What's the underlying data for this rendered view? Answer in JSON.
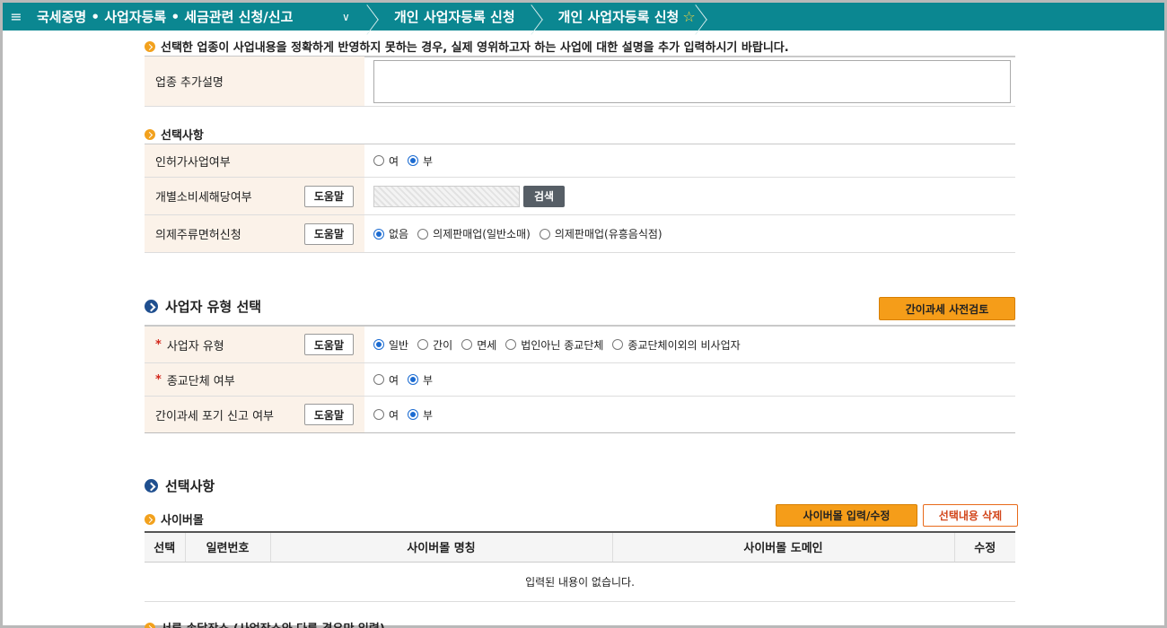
{
  "header": {
    "menu_glyph": "≡",
    "breadcrumb_root": "국세증명 • 사업자등록 • 세금관련 신청/신고",
    "breadcrumb_2": "개인 사업자등록 신청",
    "breadcrumb_3": "개인 사업자등록 신청"
  },
  "notice": "선택한 업종이 사업내용을 정확하게 반영하지 못하는 경우, 실제 영위하고자 하는 사업에 대한 설명을 추가 입력하시기 바랍니다.",
  "industry_extra": {
    "label": "업종 추가설명",
    "value": ""
  },
  "options": {
    "title": "선택사항",
    "permit": {
      "label": "인허가사업여부",
      "yes": "여",
      "no": "부",
      "selected": "부"
    },
    "excise": {
      "label": "개별소비세해당여부",
      "help": "도움말",
      "search": "검색"
    },
    "liquor": {
      "label": "의제주류면허신청",
      "help": "도움말",
      "opt1": "없음",
      "opt2": "의제판매업(일반소매)",
      "opt3": "의제판매업(유흥음식점)",
      "selected": "없음"
    }
  },
  "biztype": {
    "title": "사업자 유형 선택",
    "precheck_button": "간이과세 사전검토",
    "type": {
      "required": "*",
      "label": "사업자 유형",
      "help": "도움말",
      "opt1": "일반",
      "opt2": "간이",
      "opt3": "면세",
      "opt4": "법인아닌 종교단체",
      "opt5": "종교단체이외의 비사업자",
      "selected": "일반"
    },
    "religious": {
      "required": "*",
      "label": "종교단체 여부",
      "yes": "여",
      "no": "부",
      "selected": "부"
    },
    "simple_abandon": {
      "label": "간이과세 포기 신고 여부",
      "help": "도움말",
      "yes": "여",
      "no": "부",
      "selected": "부"
    }
  },
  "options2": {
    "title": "선택사항",
    "cybermall": {
      "title": "사이버몰",
      "input_button": "사이버몰 입력/수정",
      "delete_button": "선택내용 삭제",
      "columns": [
        "선택",
        "일련번호",
        "사이버몰 명칭",
        "사이버몰 도메인",
        "수정"
      ],
      "empty_text": "입력된 내용이 없습니다."
    },
    "next_section_partial": "서류 송달장소 (사업장소와 다른 경우만 입력)"
  }
}
